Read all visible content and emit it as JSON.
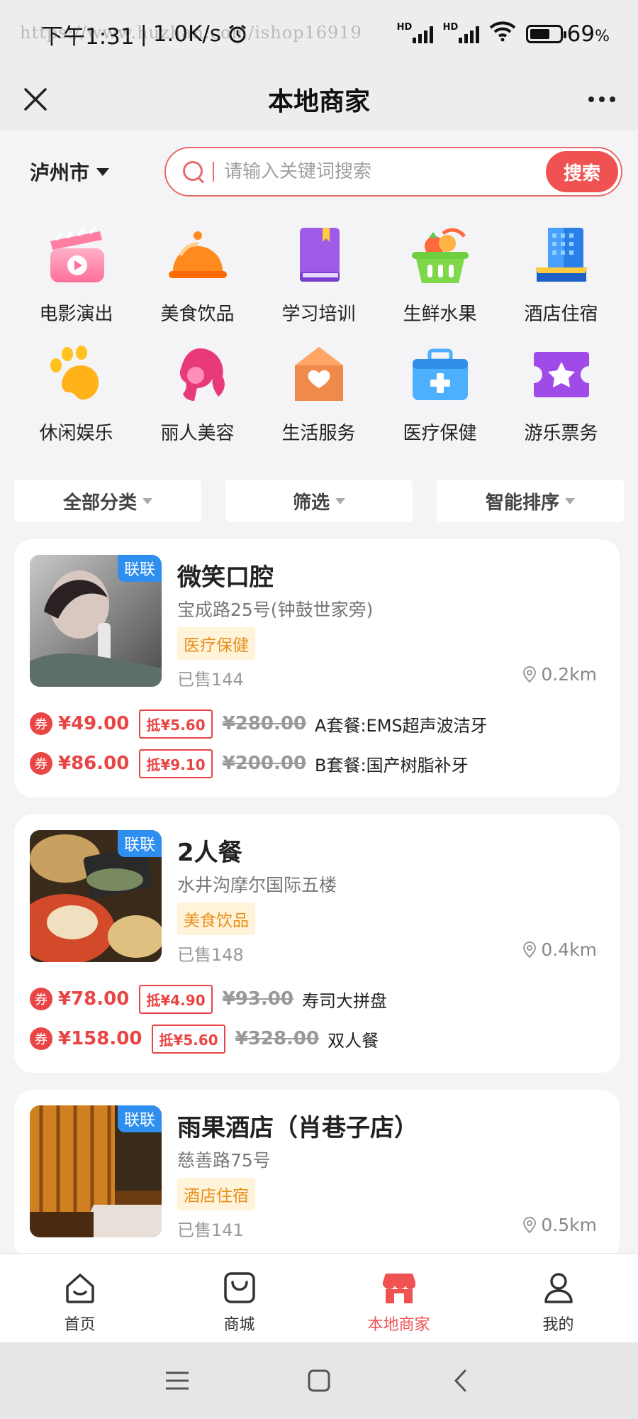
{
  "status_bar": {
    "time": "下午1:31",
    "network_speed": "1.0K/s",
    "watermark": "https://www.huzhan.com/ishop16919",
    "battery_percent": "69",
    "battery_unit": "%",
    "battery_level": 0.69
  },
  "header": {
    "title": "本地商家",
    "close_icon": "close-icon",
    "more_icon": "more-icon"
  },
  "search": {
    "city": "泸州市",
    "placeholder": "请输入关键词搜索",
    "button_label": "搜索"
  },
  "categories": [
    {
      "label": "电影演出",
      "icon": "movie-icon"
    },
    {
      "label": "美食饮品",
      "icon": "food-icon"
    },
    {
      "label": "学习培训",
      "icon": "book-icon"
    },
    {
      "label": "生鲜水果",
      "icon": "fruit-basket-icon"
    },
    {
      "label": "酒店住宿",
      "icon": "hotel-icon"
    },
    {
      "label": "休闲娱乐",
      "icon": "paw-icon"
    },
    {
      "label": "丽人美容",
      "icon": "beauty-icon"
    },
    {
      "label": "生活服务",
      "icon": "house-heart-icon"
    },
    {
      "label": "医疗保健",
      "icon": "medical-kit-icon"
    },
    {
      "label": "游乐票务",
      "icon": "ticket-icon"
    }
  ],
  "filters": [
    {
      "label": "全部分类"
    },
    {
      "label": "筛选"
    },
    {
      "label": "智能排序"
    }
  ],
  "merchants": [
    {
      "badge": "联联",
      "title": "微笑口腔",
      "address": "宝成路25号(钟鼓世家旁)",
      "tag": "医疗保健",
      "sold": "已售144",
      "distance": "0.2km",
      "deals": [
        {
          "coupon": "券",
          "price": "¥49.00",
          "offset": "抵¥5.60",
          "original": "¥280.00",
          "name": "A套餐:EMS超声波洁牙"
        },
        {
          "coupon": "券",
          "price": "¥86.00",
          "offset": "抵¥9.10",
          "original": "¥200.00",
          "name": "B套餐:国产树脂补牙"
        }
      ]
    },
    {
      "badge": "联联",
      "title": "2人餐",
      "address": "水井沟摩尔国际五楼",
      "tag": "美食饮品",
      "sold": "已售148",
      "distance": "0.4km",
      "deals": [
        {
          "coupon": "券",
          "price": "¥78.00",
          "offset": "抵¥4.90",
          "original": "¥93.00",
          "name": "寿司大拼盘"
        },
        {
          "coupon": "券",
          "price": "¥158.00",
          "offset": "抵¥5.60",
          "original": "¥328.00",
          "name": "双人餐"
        }
      ]
    },
    {
      "badge": "联联",
      "title": "雨果酒店（肖巷子店）",
      "address": "慈善路75号",
      "tag": "酒店住宿",
      "sold": "已售141",
      "distance": "0.5km",
      "deals": []
    }
  ],
  "bottom_nav": [
    {
      "label": "首页",
      "icon": "home-icon",
      "active": false
    },
    {
      "label": "商城",
      "icon": "shopping-bag-icon",
      "active": false
    },
    {
      "label": "本地商家",
      "icon": "store-icon",
      "active": true
    },
    {
      "label": "我的",
      "icon": "user-icon",
      "active": false
    }
  ],
  "colors": {
    "accent": "#f05252",
    "badge_blue": "#2e8ff0",
    "tag_text": "#e8901c",
    "tag_bg": "#fff3da"
  }
}
